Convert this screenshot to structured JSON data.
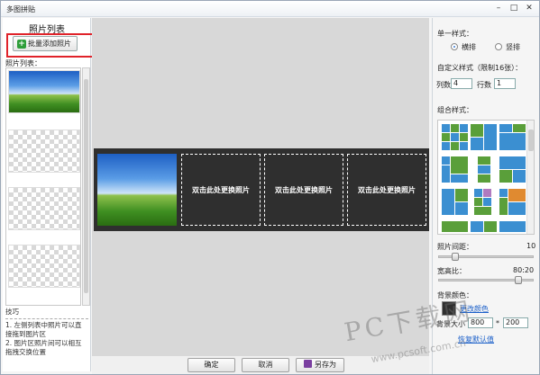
{
  "window": {
    "title": "多图拼贴",
    "minimize": "–",
    "maximize": "□",
    "close": "✕"
  },
  "left": {
    "title": "照片列表",
    "add_button": "批量添加照片",
    "list_label": "照片列表：",
    "tips_title": "技巧",
    "tips": [
      "1. 左侧列表中照片可以直接拖到图片区",
      "2. 图片区照片间可以相互拖拽交换位置"
    ]
  },
  "canvas": {
    "background": "#2f2f2f",
    "slots": [
      "",
      "双击此处更换照片",
      "双击此处更换照片",
      "双击此处更换照片"
    ]
  },
  "footer": {
    "ok": "确定",
    "cancel": "取消",
    "save_as": "另存为"
  },
  "right": {
    "single_style": "单一样式：",
    "horizontal": "横排",
    "vertical": "竖排",
    "custom_style": "自定义样式（限制16张）：",
    "columns_label": "列数",
    "columns_value": "4",
    "rows_label": "行数",
    "rows_value": "1",
    "combo_style": "组合样式：",
    "spacing_label": "照片间距：",
    "spacing_value": "10",
    "ratio_label": "宽高比：",
    "ratio_value": "80:20",
    "bg_color_label": "背景颜色：",
    "bg_color_link": "更改颜色",
    "bg_size_label": "背景大小",
    "bg_width": "800",
    "bg_sep": "*",
    "bg_height": "200",
    "reset_link": "恢复默认值"
  },
  "watermark": {
    "big": "PC下载网",
    "url": "www.pcsoft.com.cn"
  }
}
